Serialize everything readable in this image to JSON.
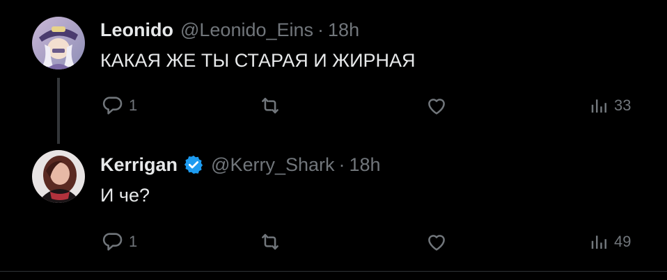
{
  "colors": {
    "background": "#000000",
    "text": "#e7e9ea",
    "muted": "#71767b",
    "verified": "#1d9bf0",
    "divider": "#2f3336"
  },
  "tweets": [
    {
      "display_name": "Leonido",
      "handle": "@Leonido_Eins",
      "separator": "·",
      "time": "18h",
      "verified": false,
      "text": "КАКАЯ ЖЕ ТЫ СТАРАЯ И ЖИРНАЯ",
      "reply_count": "1",
      "views_count": "33",
      "icons": [
        "reply-icon",
        "retweet-icon",
        "like-icon",
        "views-icon"
      ]
    },
    {
      "display_name": "Kerrigan",
      "handle": "@Kerry_Shark",
      "separator": "·",
      "time": "18h",
      "verified": true,
      "text": "И че?",
      "reply_count": "1",
      "views_count": "49",
      "icons": [
        "reply-icon",
        "retweet-icon",
        "like-icon",
        "views-icon"
      ]
    }
  ]
}
